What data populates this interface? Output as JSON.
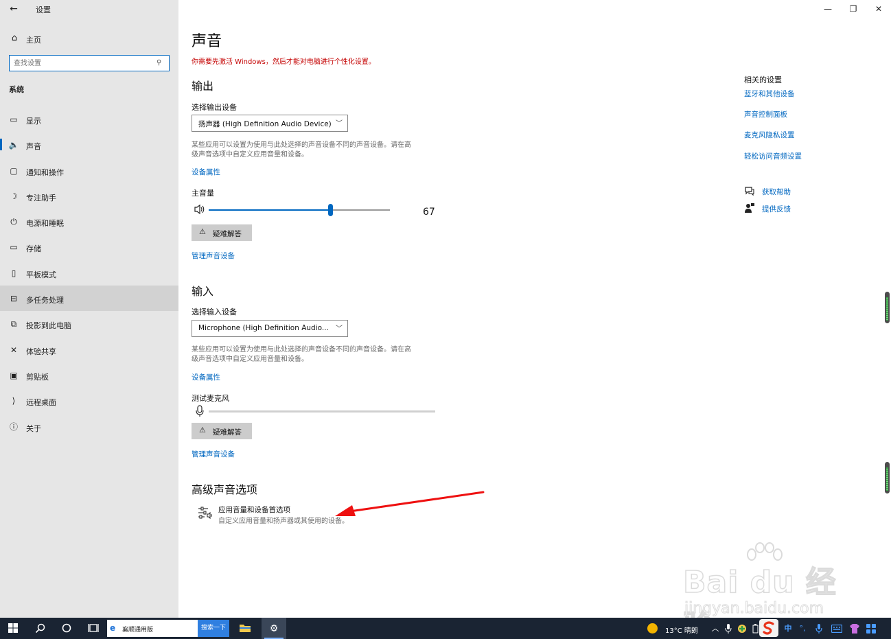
{
  "app": {
    "title": "设置",
    "back_icon": "back-arrow-icon",
    "window_controls": {
      "minimize": "—",
      "restore": "❐",
      "close": "✕"
    }
  },
  "sidebar": {
    "home_label": "主页",
    "search_placeholder": "查找设置",
    "section_label": "系统",
    "items": [
      {
        "label": "显示",
        "icon": "monitor-icon",
        "glyph": "▭"
      },
      {
        "label": "声音",
        "icon": "speaker-icon",
        "glyph": "🔈"
      },
      {
        "label": "通知和操作",
        "icon": "notification-icon",
        "glyph": "▢"
      },
      {
        "label": "专注助手",
        "icon": "moon-icon",
        "glyph": "☽"
      },
      {
        "label": "电源和睡眠",
        "icon": "power-icon",
        "glyph": "⏻"
      },
      {
        "label": "存储",
        "icon": "storage-icon",
        "glyph": "▭"
      },
      {
        "label": "平板模式",
        "icon": "tablet-icon",
        "glyph": "▯"
      },
      {
        "label": "多任务处理",
        "icon": "multitask-icon",
        "glyph": "⊟"
      },
      {
        "label": "投影到此电脑",
        "icon": "project-icon",
        "glyph": "⧉"
      },
      {
        "label": "体验共享",
        "icon": "share-icon",
        "glyph": "✕"
      },
      {
        "label": "剪贴板",
        "icon": "clipboard-icon",
        "glyph": "▣"
      },
      {
        "label": "远程桌面",
        "icon": "remote-icon",
        "glyph": "⟩"
      },
      {
        "label": "关于",
        "icon": "info-icon",
        "glyph": "ⓘ"
      }
    ]
  },
  "main": {
    "title": "声音",
    "activation_notice": "你需要先激活 Windows，然后才能对电脑进行个性化设置。",
    "output": {
      "heading": "输出",
      "device_label": "选择输出设备",
      "device_value": "扬声器 (High Definition Audio Device)",
      "description_line1": "某些应用可以设置为使用与此处选择的声音设备不同的声音设备。请在高",
      "description_line2": "级声音选项中自定义应用音量和设备。",
      "device_properties": "设备属性",
      "volume_label": "主音量",
      "volume_value": "67",
      "volume_fraction": 0.67,
      "troubleshoot": "疑难解答",
      "manage_devices": "管理声音设备"
    },
    "input": {
      "heading": "输入",
      "device_label": "选择输入设备",
      "device_value": "Microphone (High Definition Audio...",
      "description_line1": "某些应用可以设置为使用与此处选择的声音设备不同的声音设备。请在高",
      "description_line2": "级声音选项中自定义应用音量和设备。",
      "device_properties": "设备属性",
      "test_mic": "测试麦克风",
      "troubleshoot": "疑难解答",
      "manage_devices": "管理声音设备"
    },
    "advanced": {
      "heading": "高级声音选项",
      "item_title": "应用音量和设备首选项",
      "item_subtitle": "自定义应用音量和扬声器或其使用的设备。"
    }
  },
  "related": {
    "title": "相关的设置",
    "links": [
      "蓝牙和其他设备",
      "声音控制面板",
      "麦克风隐私设置",
      "轻松访问音频设置"
    ],
    "help": "获取帮助",
    "feedback": "提供反馈"
  },
  "watermark": {
    "logo": "Bai du 经验",
    "url": "jingyan.baidu.com"
  },
  "taskbar": {
    "search_text": "襄顺通用版",
    "search_button": "搜索一下",
    "weather": "13°C  晴朗",
    "ime_chinese": "中",
    "ime_punct": "°,"
  },
  "colors": {
    "accent": "#0067c0",
    "sidebar_bg": "#e6e6e6",
    "warning_red": "#c40000",
    "taskbar_bg": "#1a2433",
    "annotation_red": "#ee1111"
  }
}
